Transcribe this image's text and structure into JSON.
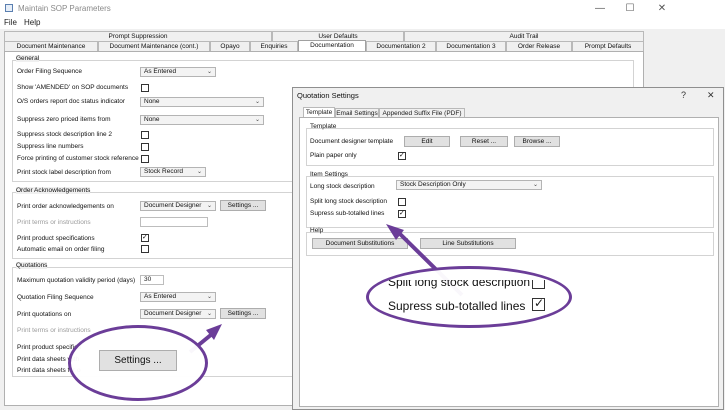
{
  "window": {
    "title": "Maintain SOP Parameters",
    "minimize_glyph": "—",
    "maximize_glyph": "☐",
    "close_glyph": "✕"
  },
  "menu": {
    "file": "File",
    "help": "Help"
  },
  "tabs_top": [
    "Prompt Suppression",
    "User Defaults",
    "Audit Trail"
  ],
  "tabs_bottom": [
    "Document Maintenance",
    "Document Maintenance (cont.)",
    "Opayo",
    "Enquiries",
    "Documentation",
    "Documentation 2",
    "Documentation 3",
    "Order Release",
    "Prompt Defaults"
  ],
  "general": {
    "title": "General",
    "order_filing_label": "Order Filing Sequence",
    "order_filing_value": "As Entered",
    "show_amended_label": "Show 'AMENDED' on SOP documents",
    "os_orders_label": "O/S orders report doc status indicator",
    "os_orders_value": "None",
    "suppress_zero_label": "Suppress zero priced items from",
    "suppress_zero_value": "None",
    "suppress_stock_desc2_label": "Suppress stock description line 2",
    "suppress_line_numbers_label": "Suppress line numbers",
    "force_printing_label": "Force printing of customer stock reference",
    "print_stock_label_label": "Print stock label description from",
    "print_stock_label_value": "Stock Record"
  },
  "order_ack": {
    "title": "Order Acknowledgements",
    "print_on_label": "Print order acknowledgements on",
    "print_on_value": "Document Designer",
    "settings_label": "Settings ...",
    "print_terms_label": "Print terms or instructions",
    "print_specs_label": "Print product specifications",
    "auto_email_label": "Automatic email on order filing"
  },
  "quotations": {
    "title": "Quotations",
    "max_validity_label": "Maximum quotation validity period (days)",
    "max_validity_value": "30",
    "filing_label": "Quotation Filing Sequence",
    "filing_value": "As Entered",
    "print_on_label": "Print quotations on",
    "print_on_value": "Document Designer",
    "settings_label": "Settings ...",
    "print_terms_label": "Print terms or instructions",
    "print_specs_label": "Print product specifica",
    "print_data_sheets_with_label": "Print data sheets with",
    "print_data_sheets_for_label": "Print data sheets for o"
  },
  "dialog": {
    "title": "Quotation Settings",
    "help_glyph": "?",
    "close_glyph": "✕",
    "tabs": [
      "Template",
      "Email Settings",
      "Appended Suffix File (PDF)"
    ],
    "template_group": "Template",
    "doc_designer_label": "Document designer template",
    "edit_label": "Edit",
    "reset_label": "Reset ...",
    "browse_label": "Browse ...",
    "plain_paper_label": "Plain paper only",
    "item_settings_group": "Item Settings",
    "long_stock_label": "Long stock description",
    "long_stock_value": "Stock Description Only",
    "split_long_label": "Split long stock description",
    "supress_sub_label": "Supress sub-totalled lines",
    "help_group": "Help",
    "doc_subst_label": "Document Substitutions",
    "line_subst_label": "Line Substitutions"
  },
  "callout_settings": {
    "button_label": "Settings ..."
  },
  "callout_zoom": {
    "split_label": "Split long stock description",
    "supress_label": "Supress sub-totalled lines"
  },
  "colors": {
    "accent": "#6b3d98",
    "window_bg": "#f0f0f0"
  }
}
